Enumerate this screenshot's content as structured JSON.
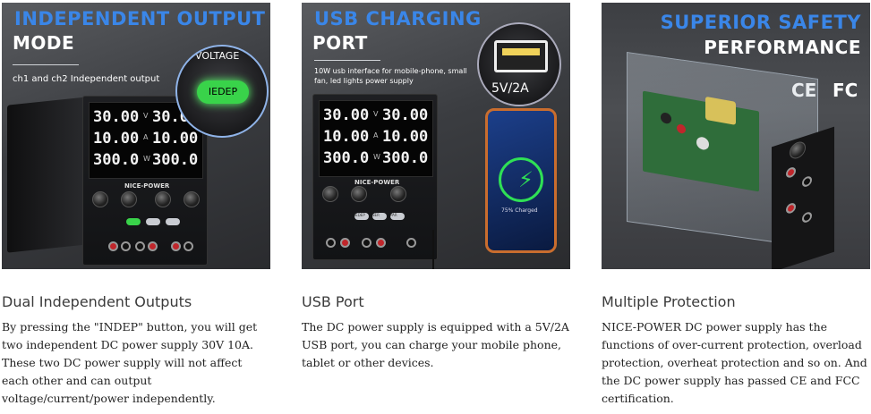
{
  "cards": [
    {
      "image": {
        "headline": "INDEPENDENT OUTPUT",
        "subheadline": "MODE",
        "subtext": "ch1 and ch2 Independent output",
        "bubble_label": "VOLTAGE",
        "bubble_button": "IEDEP",
        "display": {
          "ch1": [
            "30.00",
            "10.00",
            "300.0"
          ],
          "ch2": [
            "30.00",
            "10.00",
            "300.0"
          ],
          "units": [
            "V",
            "A",
            "W"
          ]
        },
        "brand": "NICE-POWER"
      },
      "title": "Dual Independent Outputs",
      "body": "By pressing the \"INDEP\" button, you will get two independent DC power supply 30V 10A. These two DC power supply will not affect each other and can output voltage/current/power independently."
    },
    {
      "image": {
        "headline": "USB CHARGING",
        "subheadline": "PORT",
        "subtext": "10W usb interface for mobile-phone, small fan, led lights power supply",
        "usb_rating": "5V/2A",
        "display": {
          "ch1": [
            "30.00",
            "10.00",
            "300.0"
          ],
          "ch2": [
            "30.00",
            "10.00",
            "300.0"
          ],
          "units": [
            "V",
            "A",
            "W"
          ]
        },
        "buttons": [
          "IEDEP",
          "SER",
          "PAR"
        ],
        "brand": "NICE-POWER",
        "phone_status": "75% Charged"
      },
      "title": "USB Port",
      "body": "The DC power supply is equipped with a 5V/2A USB port, you can charge your mobile phone, tablet or other devices."
    },
    {
      "image": {
        "headline": "SUPERIOR SAFETY",
        "subheadline": "PERFORMANCE",
        "cert_marks": [
          "CE",
          "FC"
        ]
      },
      "title": "Multiple Protection",
      "body": "NICE-POWER DC power supply has the functions of over-current protection, overload protection, overheat protection and so on. And the DC power supply has passed CE and FCC certification."
    }
  ],
  "colors": {
    "headline_blue": "#3a86e8",
    "indep_green": "#39d34a",
    "text_dark": "#222222"
  }
}
